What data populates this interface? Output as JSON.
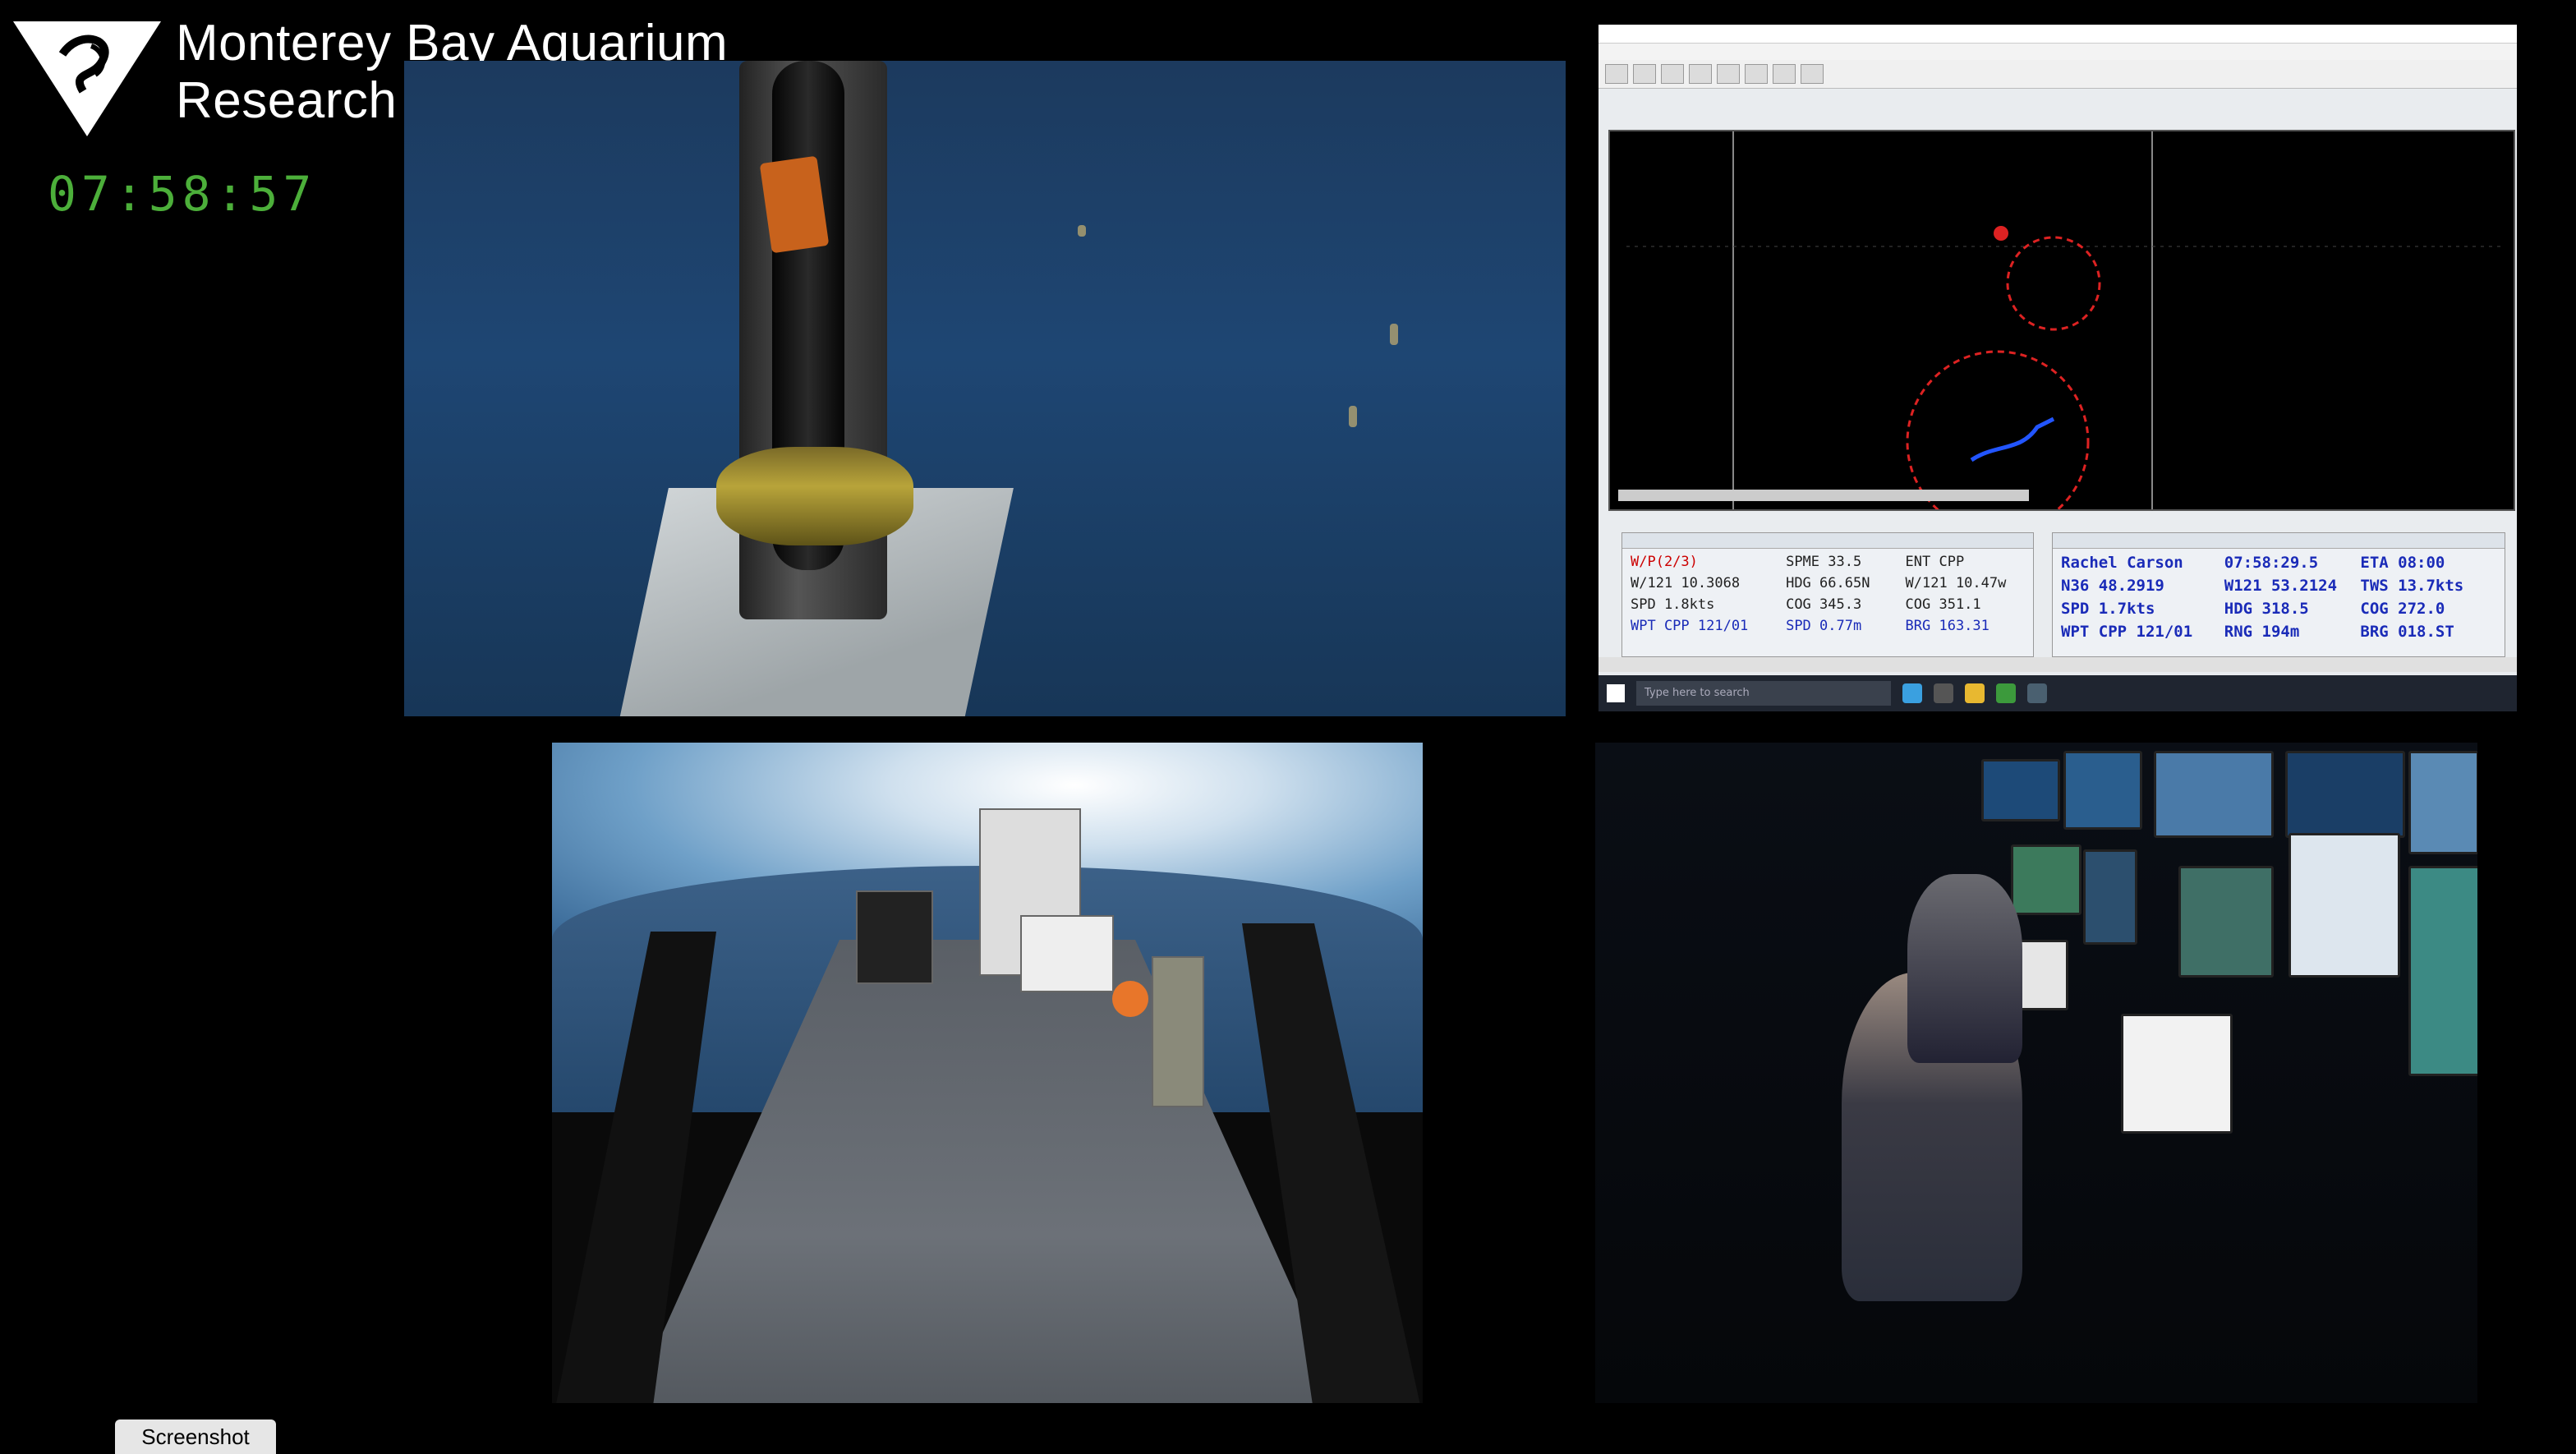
{
  "header": {
    "brand_line1": "Monterey Bay Aquarium",
    "brand_line2": "Research Institute",
    "clock": "07:58:57"
  },
  "nav_window": {
    "left_panel": {
      "rows": [
        [
          "W/P(2/3)",
          "SPME 33.5",
          "ENT CPP"
        ],
        [
          "W/121 10.3068",
          "HDG 66.65N",
          "W/121 10.47w"
        ],
        [
          "SPD 1.8kts",
          "COG 345.3",
          "COG 351.1"
        ],
        [
          "WPT CPP 121/01",
          "SPD 0.77m",
          "BRG 163.31"
        ]
      ]
    },
    "right_panel": {
      "rows": [
        [
          "Rachel Carson",
          "07:58:29.5",
          "ETA 08:00"
        ],
        [
          "N36 48.2919",
          "W121 53.2124",
          "TWS 13.7kts"
        ],
        [
          "SPD 1.7kts",
          "HDG 318.5",
          "COG 272.0"
        ],
        [
          "WPT CPP 121/01",
          "RNG 194m",
          "BRG 018.ST"
        ]
      ]
    },
    "taskbar_search": "Type here to search"
  },
  "controls": {
    "screenshot_label": "Screenshot"
  },
  "colors": {
    "clock_green": "#4caf3a",
    "nav_red": "#cc0000",
    "nav_blue": "#1a2bb8"
  }
}
